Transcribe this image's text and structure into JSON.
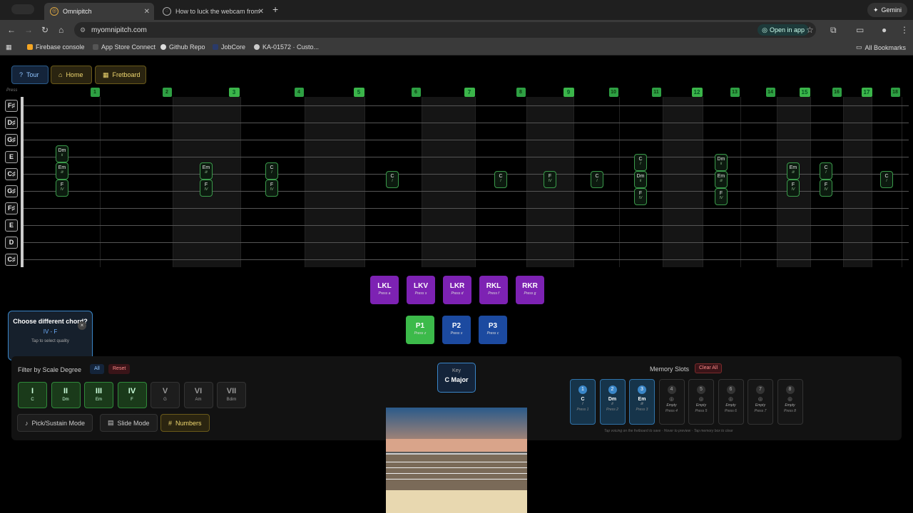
{
  "browser": {
    "tabs": [
      {
        "title": "Omnipitch",
        "active": true
      },
      {
        "title": "How to luck the webcam from",
        "active": false
      }
    ],
    "gemini_label": "Gemini",
    "url": "myomnipitch.com",
    "open_in_app": "Open in app",
    "bookmarks": [
      "Firebase console",
      "App Store Connect",
      "Github Repo",
      "JobCore",
      "KA-01572 · Custo..."
    ],
    "all_bookmarks": "All Bookmarks"
  },
  "toolbar": {
    "tour": "Tour",
    "home": "Home",
    "fretboard": "Fretboard"
  },
  "fretboard": {
    "press_label": "Press",
    "strings": [
      "F♯",
      "D♯",
      "G♯",
      "E",
      "C♯",
      "G♯",
      "F♯",
      "E",
      "D",
      "C♯"
    ],
    "frets": [
      "1",
      "2",
      "3",
      "4",
      "5",
      "6",
      "7",
      "8",
      "9",
      "10",
      "11",
      "12",
      "13",
      "14",
      "15",
      "16",
      "17",
      "18"
    ],
    "big_frets": [
      "3",
      "5",
      "7",
      "9",
      "12",
      "15",
      "17"
    ],
    "chords": [
      {
        "name": "Dm",
        "degree": "ii",
        "fret": 1,
        "string": 3
      },
      {
        "name": "Em",
        "degree": "iii",
        "fret": 1,
        "string": 4
      },
      {
        "name": "F",
        "degree": "IV",
        "fret": 1,
        "string": 5
      },
      {
        "name": "Em",
        "degree": "iii",
        "fret": 3,
        "string": 4
      },
      {
        "name": "F",
        "degree": "IV",
        "fret": 3,
        "string": 5
      },
      {
        "name": "C",
        "degree": "I",
        "fret": 4,
        "string": 4
      },
      {
        "name": "F",
        "degree": "IV",
        "fret": 4,
        "string": 5
      },
      {
        "name": "C",
        "degree": "I",
        "fret": 6,
        "string": 4.5
      },
      {
        "name": "C",
        "degree": "I",
        "fret": 8,
        "string": 4.5
      },
      {
        "name": "F",
        "degree": "IV",
        "fret": 9,
        "string": 4.5
      },
      {
        "name": "C",
        "degree": "I",
        "fret": 10,
        "string": 4.5
      },
      {
        "name": "C",
        "degree": "I",
        "fret": 11,
        "string": 3.5
      },
      {
        "name": "Dm",
        "degree": "ii",
        "fret": 11,
        "string": 4.5
      },
      {
        "name": "F",
        "degree": "IV",
        "fret": 11,
        "string": 5.5
      },
      {
        "name": "Dm",
        "degree": "ii",
        "fret": 13,
        "string": 3.5
      },
      {
        "name": "Em",
        "degree": "iii",
        "fret": 13,
        "string": 4.5
      },
      {
        "name": "F",
        "degree": "IV",
        "fret": 13,
        "string": 5.5
      },
      {
        "name": "Em",
        "degree": "iii",
        "fret": 15,
        "string": 4
      },
      {
        "name": "F",
        "degree": "IV",
        "fret": 15,
        "string": 5
      },
      {
        "name": "C",
        "degree": "I",
        "fret": 16,
        "string": 4
      },
      {
        "name": "F",
        "degree": "IV",
        "fret": 16,
        "string": 5
      },
      {
        "name": "C",
        "degree": "I",
        "fret": 18,
        "string": 4.5
      }
    ]
  },
  "pads": {
    "knee": [
      {
        "label": "LKL",
        "hint": "Press a"
      },
      {
        "label": "LKV",
        "hint": "Press s"
      },
      {
        "label": "LKR",
        "hint": "Press d"
      },
      {
        "label": "RKL",
        "hint": "Press f"
      },
      {
        "label": "RKR",
        "hint": "Press g"
      }
    ],
    "pedals": [
      {
        "label": "P1",
        "hint": "Press z",
        "active": true
      },
      {
        "label": "P2",
        "hint": "Press x",
        "active": false
      },
      {
        "label": "P3",
        "hint": "Press c",
        "active": false
      }
    ]
  },
  "popup": {
    "title": "Choose different chord?",
    "chord": "IV - F",
    "hint": "Tap to select quality",
    "close": "×"
  },
  "filter": {
    "label": "Filter by Scale Degree",
    "all": "All",
    "reset": "Reset",
    "degrees": [
      {
        "roman": "I",
        "note": "C",
        "active": true
      },
      {
        "roman": "II",
        "note": "Dm",
        "active": true
      },
      {
        "roman": "III",
        "note": "Em",
        "active": true
      },
      {
        "roman": "IV",
        "note": "F",
        "active": true
      },
      {
        "roman": "V",
        "note": "G",
        "active": false
      },
      {
        "roman": "VI",
        "note": "Am",
        "active": false
      },
      {
        "roman": "VII",
        "note": "Bdim",
        "active": false
      }
    ],
    "modes": {
      "pick": "Pick/Sustain Mode",
      "slide": "Slide Mode",
      "numbers": "Numbers"
    }
  },
  "key": {
    "label": "Key",
    "value": "C Major"
  },
  "memory": {
    "title": "Memory Slots",
    "clear_all": "Clear All",
    "slots": [
      {
        "num": "1",
        "chord": "C",
        "degree": "I",
        "press": "Press 1",
        "filled": true
      },
      {
        "num": "2",
        "chord": "Dm",
        "degree": "ii",
        "press": "Press 2",
        "filled": true
      },
      {
        "num": "3",
        "chord": "Em",
        "degree": "iii",
        "press": "Press 3",
        "filled": true
      },
      {
        "num": "4",
        "chord": "Empty",
        "degree": "",
        "press": "Press 4",
        "filled": false
      },
      {
        "num": "5",
        "chord": "Empty",
        "degree": "",
        "press": "Press 5",
        "filled": false
      },
      {
        "num": "6",
        "chord": "Empty",
        "degree": "",
        "press": "Press 6",
        "filled": false
      },
      {
        "num": "7",
        "chord": "Empty",
        "degree": "",
        "press": "Press 7",
        "filled": false
      },
      {
        "num": "8",
        "chord": "Empty",
        "degree": "",
        "press": "Press 8",
        "filled": false
      }
    ],
    "footer": "Tap voicing on the fretboard to save · Hover to preview · Tap memory box to clear"
  },
  "colors": {
    "green": "#3cba4a",
    "purple": "#7d22b3",
    "blue": "#1c4aa0",
    "accent_yellow": "#e8d24a"
  }
}
